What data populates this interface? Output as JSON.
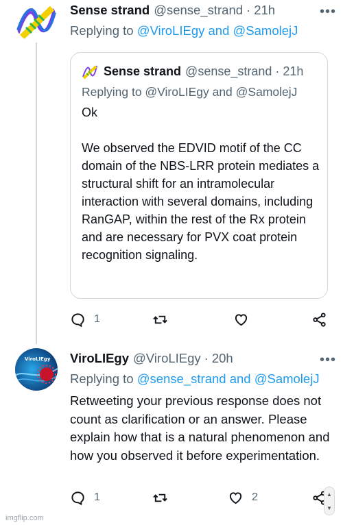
{
  "tweet1": {
    "name": "Sense strand",
    "handle": "@sense_strand",
    "dot": "·",
    "time": "21h",
    "more": "•••",
    "replying_prefix": "Replying to",
    "replying_mentions": "@ViroLIEgy and @SamolejJ",
    "quote": {
      "name": "Sense strand",
      "handle": "@sense_strand",
      "dot": "·",
      "time": "21h",
      "replying_text": "Replying to @ViroLIEgy and @SamolejJ",
      "line1": "Ok",
      "body": "We observed the EDVID motif of the CC domain of the NBS-LRR protein mediates a structural shift for an intramolecular interaction with several domains, including RanGAP, within the rest of the Rx protein and are necessary for PVX coat protein recognition signaling."
    },
    "actions": {
      "reply_count": "1",
      "retweet_count": "",
      "like_count": ""
    }
  },
  "tweet2": {
    "name": "ViroLIEgy",
    "handle": "@ViroLIEgy",
    "dot": "·",
    "time": "20h",
    "more": "•••",
    "avatar_text": "ViroLIEgy",
    "replying_prefix": "Replying to",
    "replying_mentions": "@sense_strand and @SamolejJ",
    "text": "Retweeting your previous response does not count as clarification or an answer. Please explain how that is a natural phenomenon and how you observed it before experimentation.",
    "actions": {
      "reply_count": "1",
      "retweet_count": "",
      "like_count": "2"
    }
  },
  "watermark": "imgflip.com",
  "icons": [
    "reply-icon",
    "retweet-icon",
    "like-icon",
    "share-icon",
    "more-icon"
  ],
  "colors": {
    "link": "#1d9bf0",
    "secondary": "#536471",
    "border": "#cfd9de"
  }
}
